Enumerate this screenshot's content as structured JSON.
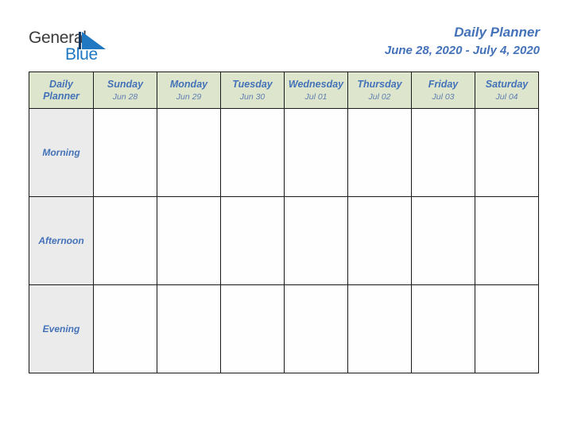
{
  "brand": {
    "name_part1": "General",
    "name_part2": "Blue",
    "mark_icon": "triangle-icon",
    "part1_color": "#3b3b3b",
    "part2_color": "#1f78c1"
  },
  "title": {
    "heading": "Daily Planner",
    "date_range": "June 28, 2020 - July 4, 2020",
    "color": "#4472b8"
  },
  "table": {
    "corner": {
      "line1": "Daily",
      "line2": "Planner"
    },
    "header_bg": "#dde5cd",
    "row_label_bg": "#ebebeb",
    "cell_bg": "#ffffff",
    "border_color": "#1a1a1a",
    "columns": [
      {
        "day": "Sunday",
        "date": "Jun 28"
      },
      {
        "day": "Monday",
        "date": "Jun 29"
      },
      {
        "day": "Tuesday",
        "date": "Jun 30"
      },
      {
        "day": "Wednesday",
        "date": "Jul 01"
      },
      {
        "day": "Thursday",
        "date": "Jul 02"
      },
      {
        "day": "Friday",
        "date": "Jul 03"
      },
      {
        "day": "Saturday",
        "date": "Jul 04"
      }
    ],
    "rows": [
      {
        "label": "Morning",
        "entries": [
          "",
          "",
          "",
          "",
          "",
          "",
          ""
        ]
      },
      {
        "label": "Afternoon",
        "entries": [
          "",
          "",
          "",
          "",
          "",
          "",
          ""
        ]
      },
      {
        "label": "Evening",
        "entries": [
          "",
          "",
          "",
          "",
          "",
          "",
          ""
        ]
      }
    ]
  }
}
